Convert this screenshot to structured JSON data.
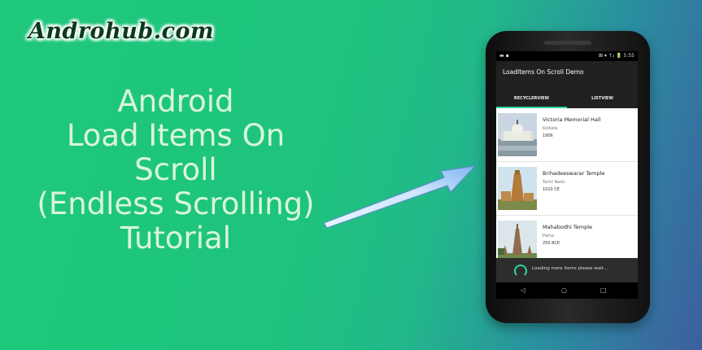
{
  "logo": {
    "text": "Androhub.com"
  },
  "headline": {
    "lines": [
      "Android",
      "Load Items On",
      "Scroll",
      "(Endless Scrolling)",
      "Tutorial"
    ],
    "color": "#d9f6d8"
  },
  "phone": {
    "status": {
      "left": "▬ ▪",
      "right": "⊠ ▾ ↑₂ 🔋 5:55",
      "time": "5:55"
    },
    "app_title": "LoadItems On Scroll Demo",
    "tabs": [
      {
        "label": "RECYCLERVIEW",
        "active": true
      },
      {
        "label": "LISTVIEW",
        "active": false
      }
    ],
    "items": [
      {
        "title": "Victoria Memorial Hall",
        "place": "Kolkata",
        "year": "1906",
        "icon": "memorial-image"
      },
      {
        "title": "Brihadeeswarar Temple",
        "place": "Tamil Nadu",
        "year": "1010 CE",
        "icon": "temple-image"
      },
      {
        "title": "Mahabodhi Temple",
        "place": "Patna",
        "year": "250 BCE",
        "icon": "stupa-image"
      }
    ],
    "loading_text": "Loading more items please wait...",
    "nav": {
      "back": "◁",
      "home": "○",
      "recents": "□"
    },
    "accent": "#2fd6a0"
  },
  "background": {
    "start": "#1fc97c",
    "end": "#3d5f9f"
  }
}
